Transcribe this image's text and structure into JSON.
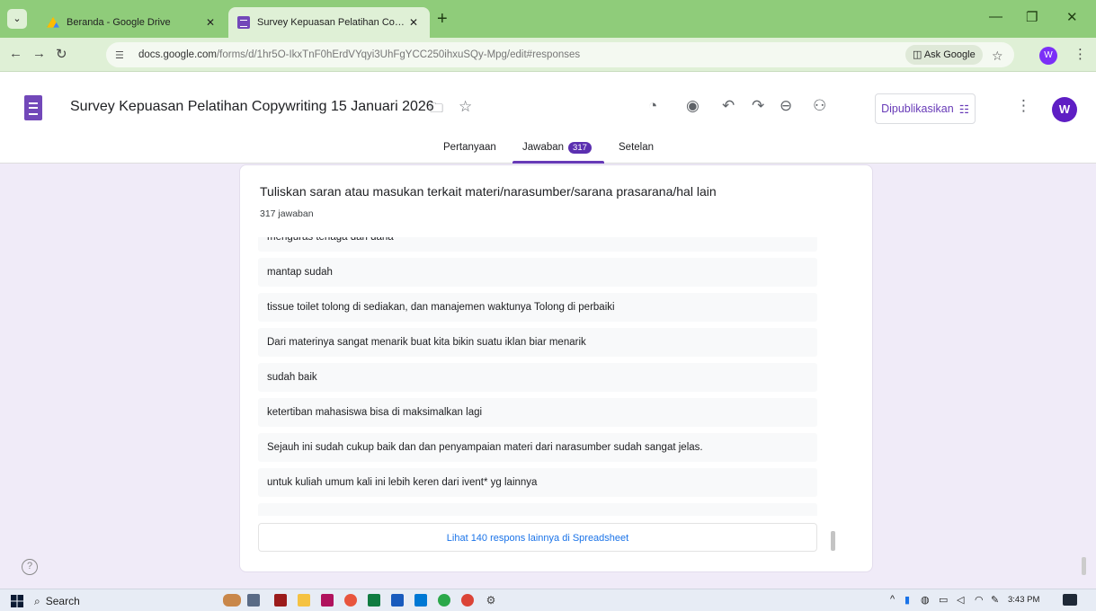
{
  "browser": {
    "tabs": [
      {
        "title": "Beranda - Google Drive",
        "favicon": "google-drive-icon",
        "active": false
      },
      {
        "title": "Survey Kepuasan Pelatihan Cop...",
        "favicon": "google-forms-icon",
        "active": true
      }
    ],
    "url_host": "docs.google.com",
    "url_path": "/forms/d/1hr5O-IkxTnF0hErdVYqyi3UhFgYCC250ihxuSQy-Mpg/edit#responses",
    "ask_google_label": "Ask Google",
    "profile_initial": "W"
  },
  "form_header": {
    "title": "Survey Kepuasan Pelatihan Copywriting 15 Januari 2026",
    "publish_label": "Dipublikasikan",
    "avatar_initial": "W",
    "tabs": [
      {
        "label": "Pertanyaan",
        "active": false
      },
      {
        "label": "Jawaban",
        "active": true,
        "badge": "317"
      },
      {
        "label": "Setelan",
        "active": false
      }
    ]
  },
  "question": {
    "title": "Tuliskan saran atau masukan terkait materi/narasumber/sarana prasarana/hal lain",
    "count_text": "317 jawaban",
    "responses": [
      "menguras tenaga dan dana",
      "mantap sudah",
      "tissue toilet tolong di sediakan, dan manajemen waktunya Tolong di perbaiki",
      "Dari materinya sangat menarik buat kita bikin suatu iklan biar menarik",
      "sudah baik",
      "ketertiban mahasiswa bisa di maksimalkan lagi",
      "Sejauh ini sudah cukup baik dan dan penyampaian materi dari narasumber sudah sangat jelas.",
      "untuk kuliah umum kali ini lebih keren dari ivent* yg lainnya"
    ],
    "more_link": "Lihat 140 respons lainnya di Spreadsheet"
  },
  "taskbar": {
    "search_label": "Search",
    "time": "3:43 PM"
  },
  "colors": {
    "accent": "#673ab7",
    "page_bg": "#f0ebf8",
    "link": "#1a73e8"
  }
}
